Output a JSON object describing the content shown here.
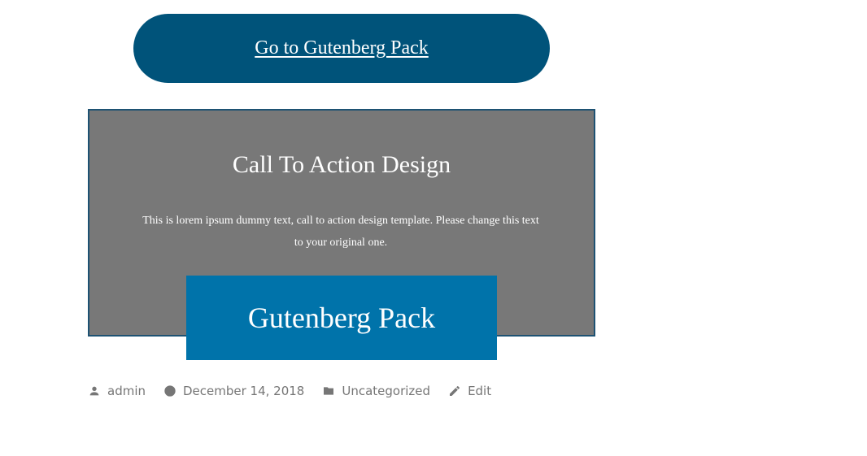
{
  "top_button": {
    "label": "Go to Gutenberg Pack"
  },
  "cta": {
    "title": "Call To Action Design",
    "description": "This is lorem ipsum dummy text, call to action design template. Please change this text to your original one.",
    "button_label": "Gutenberg Pack"
  },
  "meta": {
    "author": "admin",
    "date": "December 14, 2018",
    "category": "Uncategorized",
    "edit": "Edit",
    "icons": {
      "author": "person-icon",
      "date": "clock-icon",
      "category": "folder-icon",
      "edit": "pencil-icon"
    }
  },
  "colors": {
    "top_button_bg": "#00537a",
    "cta_box_bg": "#787878",
    "cta_box_border": "#1e5273",
    "cta_button_bg": "#0073aa",
    "meta_text": "#767676"
  }
}
